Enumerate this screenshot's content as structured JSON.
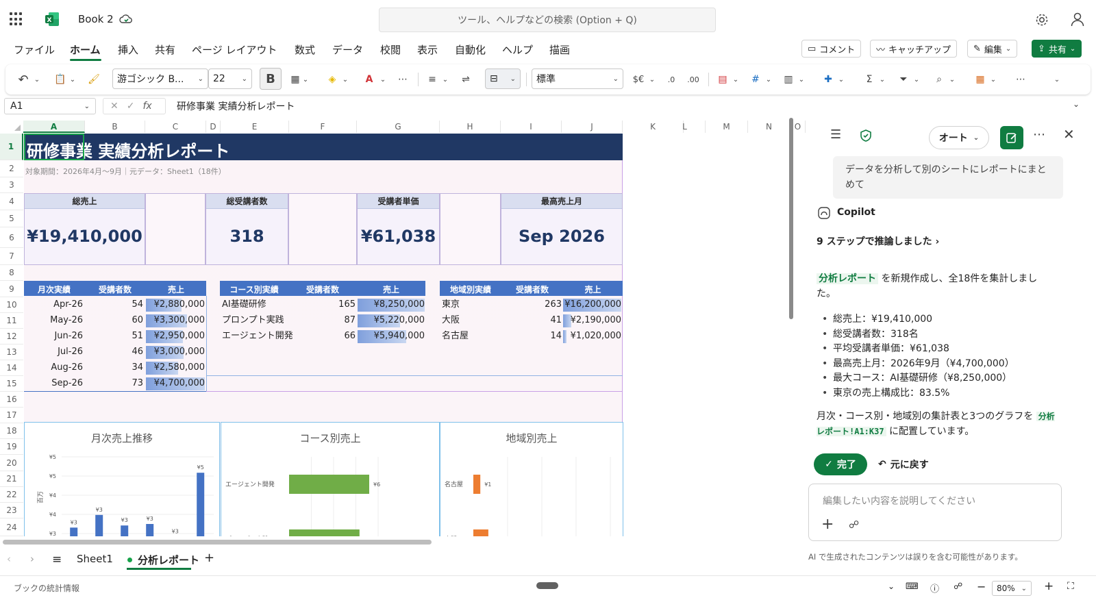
{
  "app": {
    "title": "Book 2",
    "search_placeholder": "ツール、ヘルプなどの検索 (Option + Q)"
  },
  "menu": {
    "items": [
      "ファイル",
      "ホーム",
      "挿入",
      "共有",
      "ページ レイアウト",
      "数式",
      "データ",
      "校閲",
      "表示",
      "自動化",
      "ヘルプ",
      "描画"
    ],
    "active": "ホーム",
    "comment_label": "コメント",
    "catchup_label": "キャッチアップ",
    "edit_label": "編集",
    "share_label": "共有"
  },
  "ribbon": {
    "font_name": "游ゴシック B...",
    "font_size": "22",
    "bold_label": "B",
    "number_format": "標準",
    "currency_label": "$€"
  },
  "formula_bar": {
    "name_box": "A1",
    "fx_label": "fx",
    "formula": "研修事業 実績分析レポート"
  },
  "grid": {
    "columns": [
      "A",
      "B",
      "C",
      "D",
      "E",
      "F",
      "G",
      "H",
      "I",
      "J",
      "K",
      "L",
      "M",
      "N",
      "O"
    ],
    "rows": [
      "1",
      "2",
      "3",
      "4",
      "5",
      "6",
      "7",
      "8",
      "9",
      "10",
      "11",
      "12",
      "13",
      "14",
      "15",
      "16",
      "17",
      "18",
      "19",
      "20",
      "21",
      "22",
      "23",
      "24"
    ],
    "selected_column": "A",
    "selected_row": "1"
  },
  "report": {
    "title": "研修事業 実績分析レポート",
    "subtitle": "対象期間：2026年4月〜9月｜元データ：Sheet1（18件）",
    "kpis": [
      {
        "label": "総売上",
        "value": "¥19,410,000"
      },
      {
        "label": "総受講者数",
        "value": "318"
      },
      {
        "label": "受講者単価",
        "value": "¥61,038"
      },
      {
        "label": "最高売上月",
        "value": "Sep 2026"
      }
    ],
    "monthly": {
      "headers": [
        "月次実績",
        "受講者数",
        "売上"
      ],
      "rows": [
        {
          "month": "Apr-26",
          "count": "54",
          "sales": "¥2,880,000",
          "bar": 0.61
        },
        {
          "month": "May-26",
          "count": "60",
          "sales": "¥3,300,000",
          "bar": 0.7
        },
        {
          "month": "Jun-26",
          "count": "51",
          "sales": "¥2,950,000",
          "bar": 0.63
        },
        {
          "month": "Jul-26",
          "count": "46",
          "sales": "¥3,000,000",
          "bar": 0.64
        },
        {
          "month": "Aug-26",
          "count": "34",
          "sales": "¥2,580,000",
          "bar": 0.55
        },
        {
          "month": "Sep-26",
          "count": "73",
          "sales": "¥4,700,000",
          "bar": 1.0
        }
      ]
    },
    "course": {
      "headers": [
        "コース別実績",
        "受講者数",
        "売上"
      ],
      "rows": [
        {
          "name": "AI基礎研修",
          "count": "165",
          "sales": "¥8,250,000",
          "bar": 1.0
        },
        {
          "name": "プロンプト実践",
          "count": "87",
          "sales": "¥5,220,000",
          "bar": 0.63
        },
        {
          "name": "エージェント開発",
          "count": "66",
          "sales": "¥5,940,000",
          "bar": 0.72
        }
      ]
    },
    "region": {
      "headers": [
        "地域別実績",
        "受講者数",
        "売上"
      ],
      "rows": [
        {
          "name": "東京",
          "count": "263",
          "sales": "¥16,200,000",
          "bar": 1.0
        },
        {
          "name": "大阪",
          "count": "41",
          "sales": "¥2,190,000",
          "bar": 0.14
        },
        {
          "name": "名古屋",
          "count": "14",
          "sales": "¥1,020,000",
          "bar": 0.06
        }
      ]
    }
  },
  "chart_data": [
    {
      "type": "bar",
      "title": "月次売上推移",
      "ylabel": "百万",
      "categories": [
        "Apr-26",
        "May-26",
        "Jun-26",
        "Jul-26",
        "Aug-26",
        "Sep-26"
      ],
      "values": [
        2.88,
        3.3,
        2.95,
        3.0,
        2.58,
        4.7
      ],
      "data_labels": [
        "¥3",
        "¥3",
        "¥3",
        "¥3",
        "¥3",
        "¥5"
      ],
      "ytick_labels": [
        "¥5",
        "¥5",
        "¥4",
        "¥4",
        "¥3"
      ],
      "ylim": [
        2.5,
        5.0
      ],
      "color": "#4472c4"
    },
    {
      "type": "bar",
      "title": "コース別売上",
      "orientation": "horizontal",
      "categories": [
        "エージェント開発",
        "プロンプト実践"
      ],
      "values": [
        5.94,
        5.22
      ],
      "data_labels": [
        "¥6",
        ""
      ],
      "color": "#70ad47"
    },
    {
      "type": "bar",
      "title": "地域別売上",
      "orientation": "horizontal",
      "categories": [
        "名古屋",
        "大阪"
      ],
      "values": [
        1.02,
        2.19
      ],
      "data_labels": [
        "¥1",
        ""
      ],
      "color": "#ed7d31"
    }
  ],
  "tabs": {
    "sheets": [
      "Sheet1",
      "分析レポート"
    ],
    "active": "分析レポート"
  },
  "status": {
    "left_text": "ブックの統計情報",
    "zoom": "80%"
  },
  "copilot": {
    "mode_label": "オート",
    "user_message": "データを分析して別のシートにレポートにまとめて",
    "name": "Copilot",
    "steps_label": "9 ステップで推論しました",
    "intro_link": "分析レポート",
    "intro_text": "を新規作成し、全18件を集計しました。",
    "bullets": [
      "総売上：¥19,410,000",
      "総受講者数：318名",
      "平均受講者単価：¥61,038",
      "最高売上月：2026年9月（¥4,700,000）",
      "最大コース：AI基礎研修（¥8,250,000）",
      "東京の売上構成比：83.5%"
    ],
    "summary_before": "月次・コース別・地域別の集計表と3つのグラフを",
    "summary_link": "分析レポート!A1:K37",
    "summary_after": "に配置しています。",
    "done_label": "完了",
    "undo_label": "元に戻す",
    "input_placeholder": "編集したい内容を説明してください",
    "disclaimer": "AI で生成されたコンテンツは誤りを含む可能性があります。"
  },
  "colors": {
    "accent": "#107c41",
    "title_band": "#203864",
    "table_header": "#4472c4",
    "course_bar": "#70ad47",
    "region_bar": "#ed7d31"
  }
}
